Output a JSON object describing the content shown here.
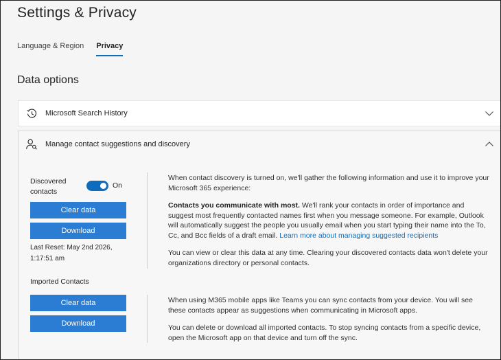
{
  "page": {
    "title": "Settings & Privacy",
    "tabs": [
      {
        "label": "Language & Region"
      },
      {
        "label": "Privacy"
      }
    ],
    "section_title": "Data options"
  },
  "search_history": {
    "title": "Microsoft Search History",
    "icon": "history-icon"
  },
  "contacts": {
    "title": "Manage contact suggestions and discovery",
    "icon": "person-search-icon",
    "discovered": {
      "label": "Discovered contacts",
      "toggle_state": "On",
      "clear_label": "Clear data",
      "download_label": "Download",
      "last_reset": "Last Reset: May 2nd 2026, 1:17:51 am",
      "desc_intro": "When contact discovery is turned on, we'll gather the following information and use it to improve your Microsoft 365 experience:",
      "desc_bold": "Contacts you communicate with most.",
      "desc_body": " We'll rank your contacts in order of importance and suggest most frequently contacted names first when you message someone. For example, Outlook will automatically suggest the people you usually email when you start typing their name into the To, Cc, and Bcc fields of a draft email. ",
      "desc_link": "Learn more about managing suggested recipients",
      "desc_clear": "You can view or clear this data at any time. Clearing your discovered contacts data won't delete your organizations directory or personal contacts."
    },
    "imported": {
      "label": "Imported Contacts",
      "clear_label": "Clear data",
      "download_label": "Download",
      "desc_sync": "When using M365 mobile apps like Teams you can sync contacts from your device. You will see these contacts appear as suggestions when communicating in Microsoft apps.",
      "desc_delete": "You can delete or download all imported contacts. To stop syncing contacts from a specific device, open the Microsoft app on that device and turn off the sync."
    }
  },
  "colors": {
    "accent": "#0f6cbd",
    "button": "#2b7cd3"
  }
}
